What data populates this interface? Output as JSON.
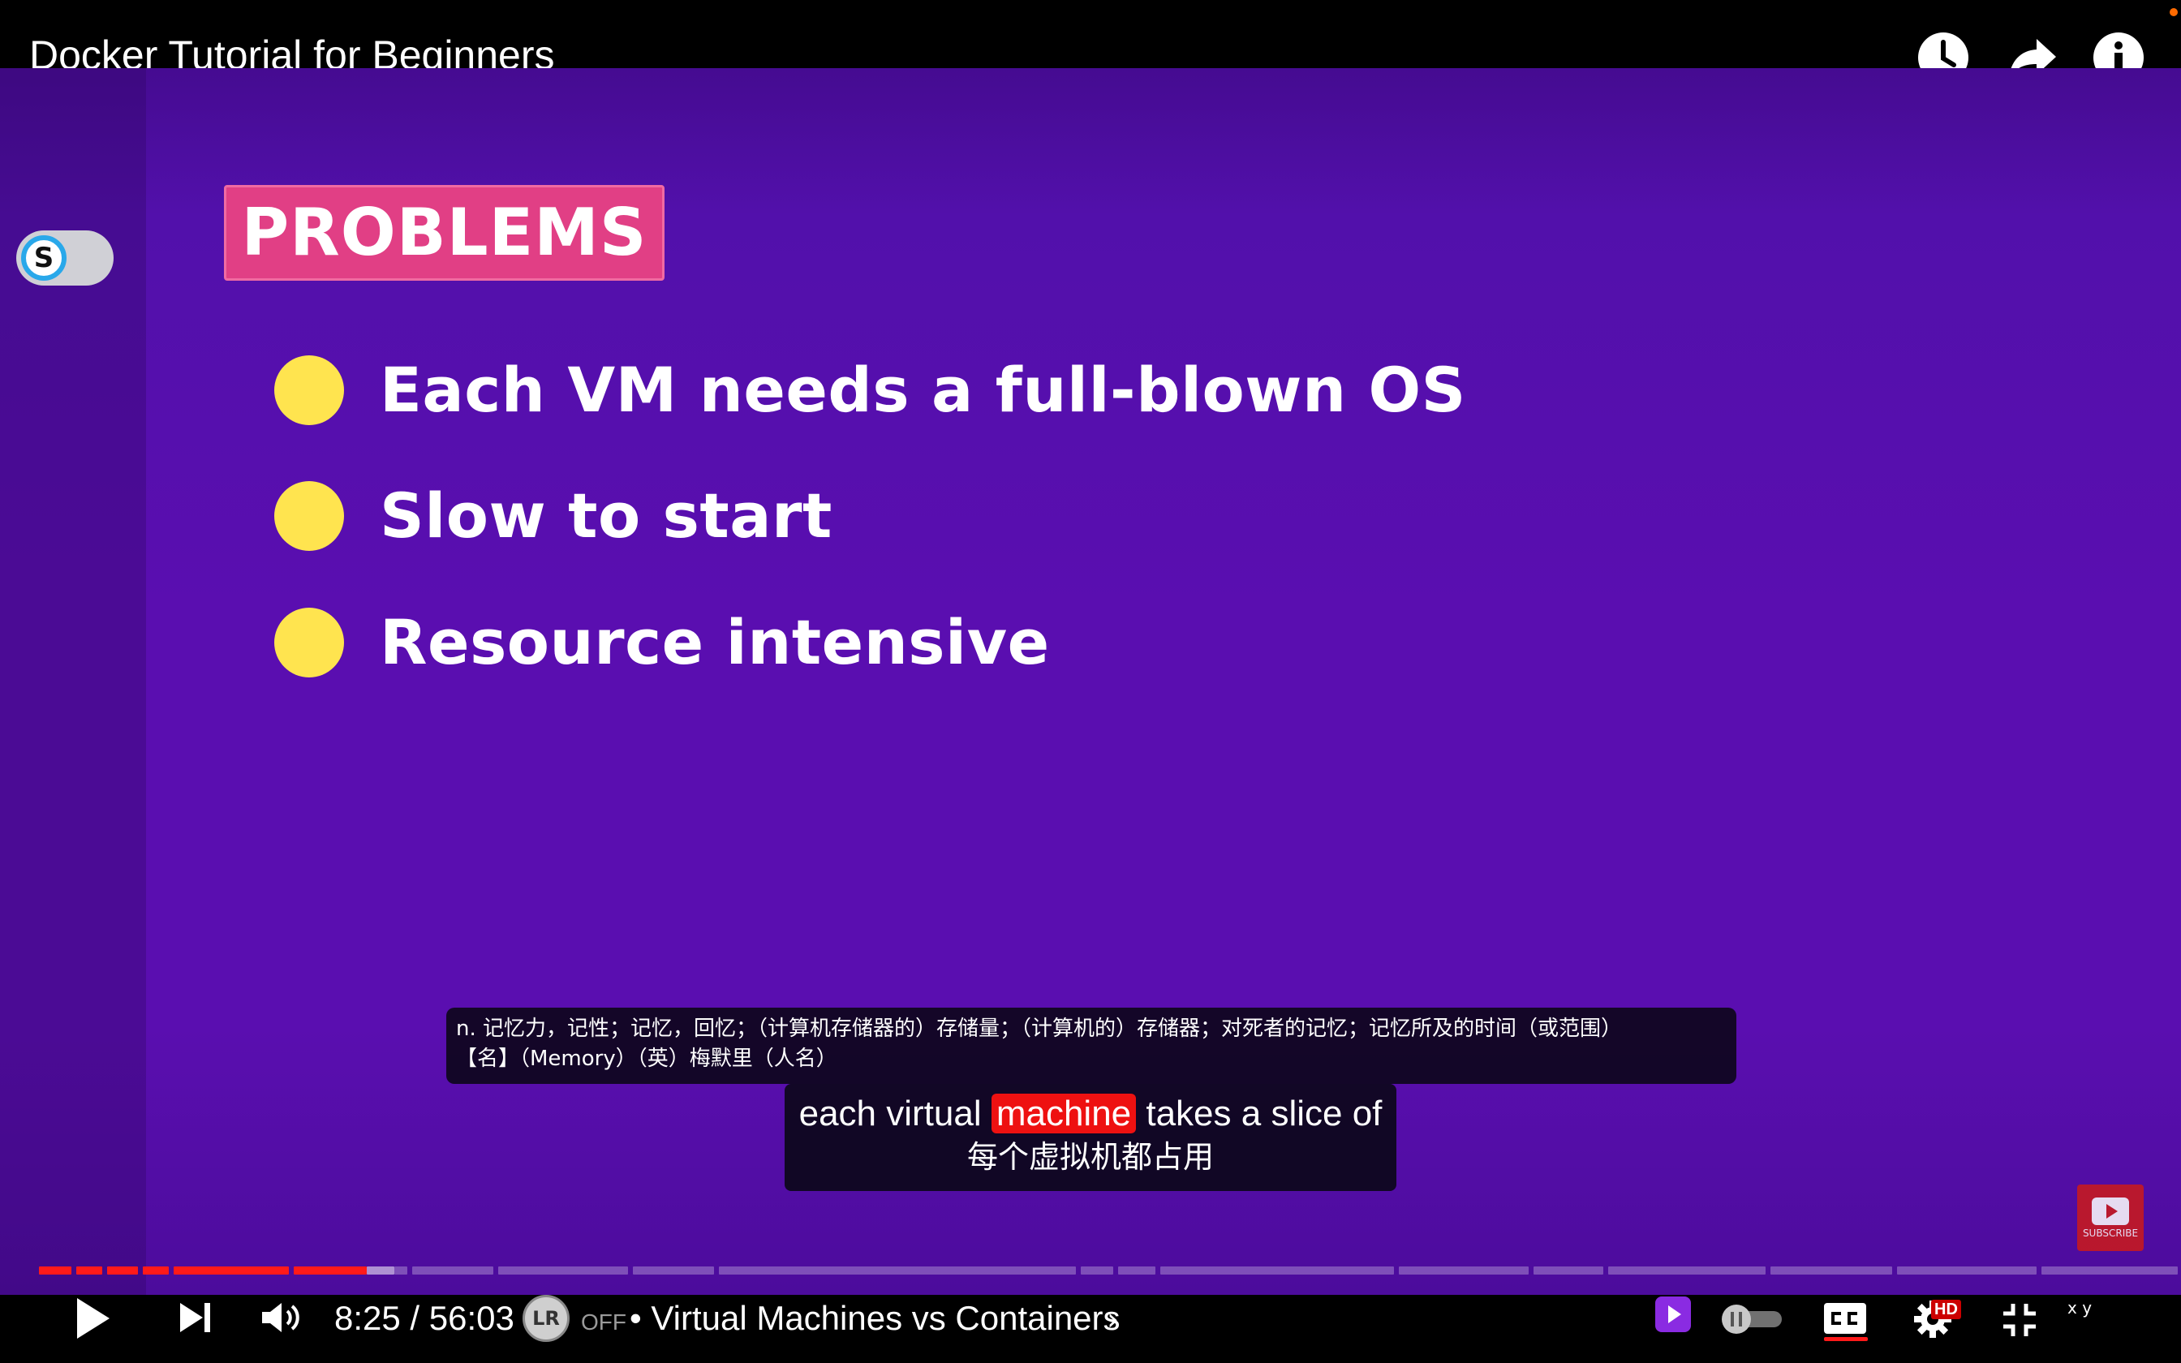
{
  "header": {
    "title": "Docker Tutorial for Beginners",
    "icons": [
      "clock-icon",
      "share-icon",
      "info-icon"
    ]
  },
  "slide": {
    "badge": "PROBLEMS",
    "bullets": [
      "Each VM needs a full-blown OS",
      "Slow to start",
      "Resource intensive"
    ],
    "colors": {
      "background": "#5a0eb0",
      "badge": "#e13f85",
      "bullet_dot": "#ffe44f"
    }
  },
  "extension_toggle": {
    "letter": "S"
  },
  "dictionary": {
    "line1": "n. 记忆力，记性；记忆，回忆；（计算机存储器的）存储量；（计算机的）存储器；对死者的记忆；记忆所及的时间（或范围）",
    "line2": "【名】（Memory）（英）梅默里（人名）"
  },
  "subtitle": {
    "before": "each virtual ",
    "highlight": "machine",
    "after": " takes a slice of",
    "translation": "每个虚拟机都占用"
  },
  "watermark": {
    "label": "SUBSCRIBE"
  },
  "player": {
    "current_time": "8:25",
    "duration": "56:03",
    "time_display": "8:25 / 56:03",
    "played_fraction": 0.15,
    "lr_label": "LR",
    "lr_state": "OFF",
    "chapter_title": "• Virtual Machines vs Containers",
    "chapter_chevron": "›",
    "hd_label": "HD",
    "xy_label": "x y",
    "accent_color": "#ff1a1a"
  }
}
